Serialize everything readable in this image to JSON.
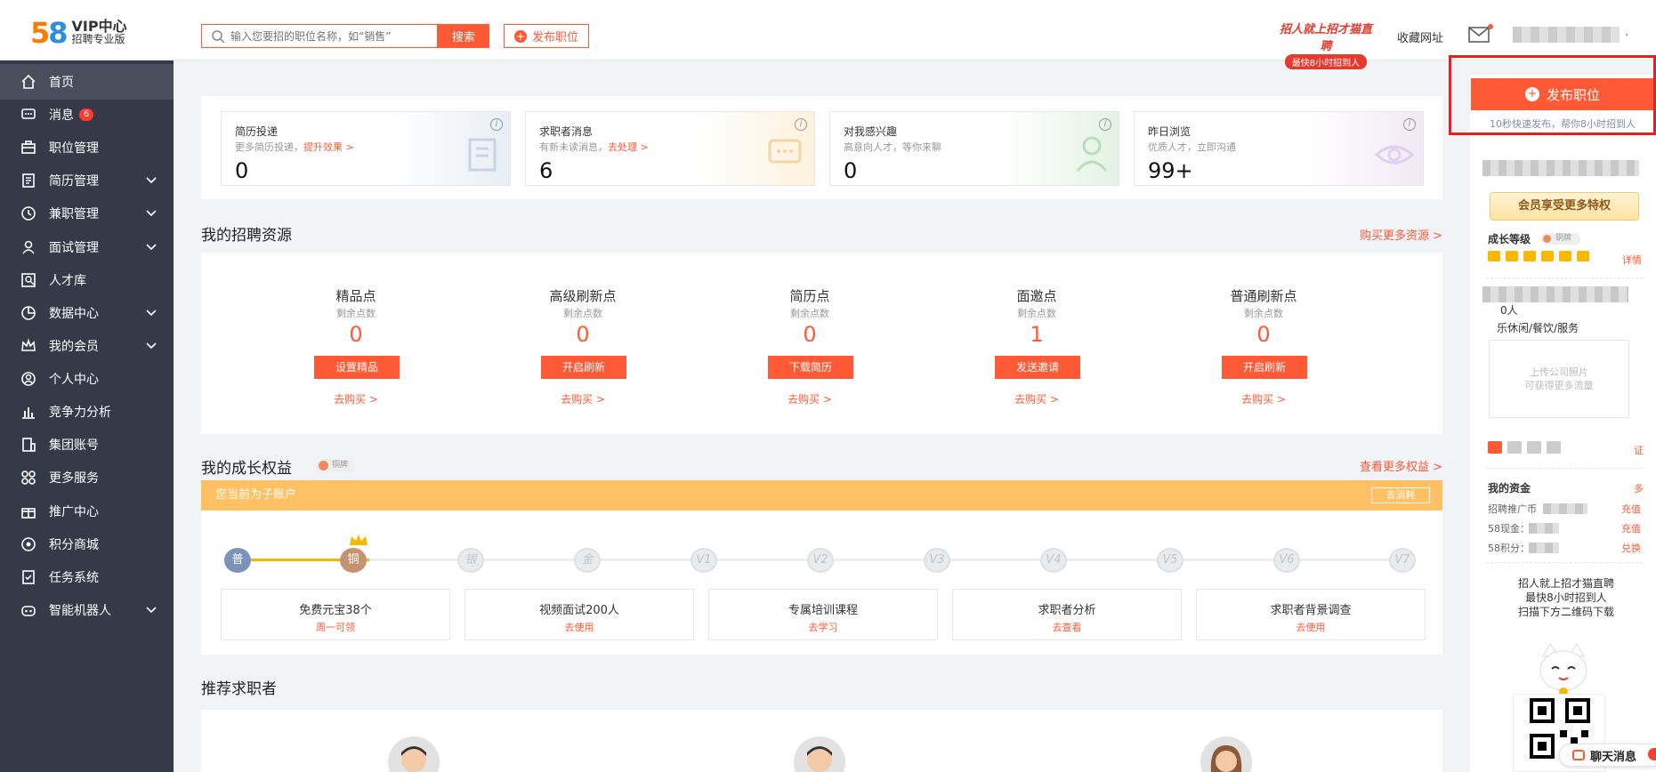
{
  "header": {
    "logo_number": "58",
    "logo_line1": "VIP中心",
    "logo_line2": "招聘专业版",
    "search_placeholder": "输入您要招的职位名称，如“销售”",
    "search_button": "搜索",
    "post_job": "发布职位",
    "promo_line1": "招人就上招才猫直聘",
    "promo_line2": "最快8小时招到人",
    "favorites": "收藏网址",
    "caret": "."
  },
  "sidebar": {
    "items": [
      {
        "label": "首页",
        "icon": "home-icon",
        "active": true
      },
      {
        "label": "消息",
        "icon": "message-icon",
        "badge": "6"
      },
      {
        "label": "职位管理",
        "icon": "briefcase-icon"
      },
      {
        "label": "简历管理",
        "icon": "resume-icon",
        "expandable": true
      },
      {
        "label": "兼职管理",
        "icon": "clock-icon",
        "expandable": true
      },
      {
        "label": "面试管理",
        "icon": "interview-icon",
        "expandable": true
      },
      {
        "label": "人才库",
        "icon": "talent-icon"
      },
      {
        "label": "数据中心",
        "icon": "chart-pie-icon",
        "expandable": true
      },
      {
        "label": "我的会员",
        "icon": "crown-icon",
        "expandable": true
      },
      {
        "label": "个人中心",
        "icon": "user-icon"
      },
      {
        "label": "竞争力分析",
        "icon": "bar-chart-icon"
      },
      {
        "label": "集团账号",
        "icon": "group-icon"
      },
      {
        "label": "更多服务",
        "icon": "grid-icon"
      },
      {
        "label": "推广中心",
        "icon": "gift-icon"
      },
      {
        "label": "积分商城",
        "icon": "points-icon"
      },
      {
        "label": "任务系统",
        "icon": "task-icon"
      },
      {
        "label": "智能机器人",
        "icon": "robot-icon",
        "expandable": true
      }
    ]
  },
  "stats": [
    {
      "title": "简历投递",
      "sub": "更多简历投递，",
      "link": "提升效果 >",
      "value": "0",
      "info": "i",
      "color": "#e8edf5"
    },
    {
      "title": "求职者消息",
      "sub": "有新未读消息，",
      "link": "去处理 >",
      "value": "6",
      "info": "i",
      "color": "#fdf1dc"
    },
    {
      "title": "对我感兴趣",
      "sub": "高意向人才，等你来聊",
      "link": "",
      "value": "0",
      "info": "i",
      "color": "#e3f2e4"
    },
    {
      "title": "昨日浏览",
      "sub": "优质人才，立即沟通",
      "link": "",
      "value": "99+",
      "info": "i",
      "color": "#f1e9f6"
    }
  ],
  "resources": {
    "title": "我的招聘资源",
    "more": "购买更多资源 >",
    "items": [
      {
        "name": "精品点",
        "sub": "剩余点数",
        "num": "0",
        "btn": "设置精品",
        "buy": "去购买 >"
      },
      {
        "name": "高级刷新点",
        "sub": "剩余点数",
        "num": "0",
        "btn": "开启刷新",
        "buy": "去购买 >"
      },
      {
        "name": "简历点",
        "sub": "剩余点数",
        "num": "0",
        "btn": "下载简历",
        "buy": "去购买 >"
      },
      {
        "name": "面邀点",
        "sub": "剩余点数",
        "num": "1",
        "btn": "发送邀请",
        "buy": "去购买 >"
      },
      {
        "name": "普通刷新点",
        "sub": "剩余点数",
        "num": "0",
        "btn": "开启刷新",
        "buy": "去购买 >"
      }
    ]
  },
  "growth": {
    "title": "我的成长权益",
    "badge": "铜牌",
    "more": "查看更多权益 >",
    "sub_account": "您当前为子账户",
    "go_consume": "去消耗",
    "levels": [
      "普",
      "铜",
      "银",
      "金",
      "V1",
      "V2",
      "V3",
      "V4",
      "V5",
      "V6",
      "V7"
    ],
    "benefits": [
      {
        "title": "免费元宝38个",
        "action": "周一可领"
      },
      {
        "title": "视频面试200人",
        "action": "去使用"
      },
      {
        "title": "专属培训课程",
        "action": "去学习"
      },
      {
        "title": "求职者分析",
        "action": "去查看"
      },
      {
        "title": "求职者背景调查",
        "action": "去使用"
      }
    ]
  },
  "recommend": {
    "title": "推荐求职者"
  },
  "right": {
    "post_job": "发布职位",
    "post_tip": "10秒快速发布，帮你8小时招到人",
    "vip_banner": "会员享受更多特权",
    "growth_level": "成长等级",
    "badge": "铜牌",
    "details": "详情",
    "count_suffix": "0人",
    "industry": "乐休闲/餐饮/服务",
    "upload_line1": "上传公司照片",
    "upload_line2": "可获得更多流量",
    "cert_link": "证",
    "funds_title": "我的资金",
    "funds_more": "多",
    "fund_rows": [
      {
        "label": "招聘推广币",
        "action": "充值"
      },
      {
        "label": "58现金：",
        "action": "充值"
      },
      {
        "label": "58积分：",
        "action": "兑换"
      }
    ],
    "qr_line1": "招人就上招才猫直聘",
    "qr_line2": "最快8小时招到人",
    "qr_line3": "扫描下方二维码下载",
    "chat": "聊天消息"
  }
}
